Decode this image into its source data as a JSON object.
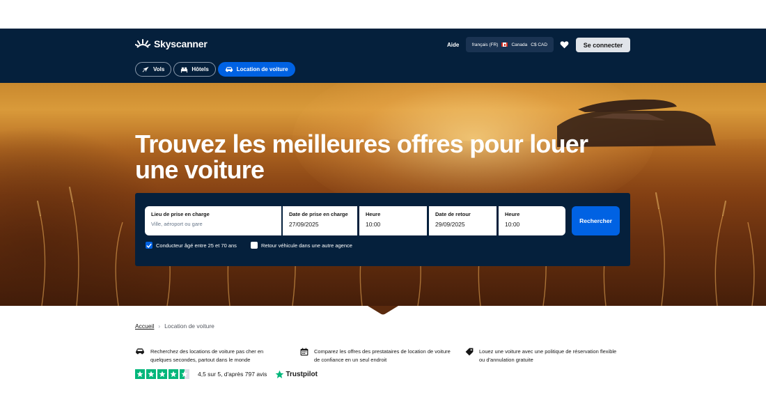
{
  "brand": {
    "name": "Skyscanner"
  },
  "header": {
    "help_label": "Aide",
    "locale": {
      "language": "français (FR)",
      "country": "Canada",
      "currency": "C$ CAD"
    },
    "login_label": "Se connecter"
  },
  "nav": {
    "tabs": [
      {
        "label": "Vols",
        "icon": "plane-icon",
        "active": false
      },
      {
        "label": "Hôtels",
        "icon": "bed-icon",
        "active": false
      },
      {
        "label": "Location de voiture",
        "icon": "car-icon",
        "active": true
      }
    ]
  },
  "hero": {
    "headline": "Trouvez les meilleures offres pour louer une voiture"
  },
  "search": {
    "pickup_location": {
      "label": "Lieu de prise en charge",
      "placeholder": "Ville, aéroport ou gare"
    },
    "pickup_date": {
      "label": "Date de prise en charge",
      "value": "27/09/2025"
    },
    "pickup_time": {
      "label": "Heure",
      "value": "10:00"
    },
    "return_date": {
      "label": "Date de retour",
      "value": "29/09/2025"
    },
    "return_time": {
      "label": "Heure",
      "value": "10:00"
    },
    "submit_label": "Rechercher",
    "options": [
      {
        "label": "Conducteur âgé entre 25 et 70 ans",
        "checked": true
      },
      {
        "label": "Retour véhicule dans une autre agence",
        "checked": false
      }
    ]
  },
  "breadcrumb": {
    "home": "Accueil",
    "separator": "›",
    "current": "Location de voiture"
  },
  "features": [
    {
      "icon": "car-icon",
      "text": "Recherchez des locations de voiture pas cher en quelques secondes, partout dans le monde"
    },
    {
      "icon": "calendar-icon",
      "text": "Comparez les offres des prestataires de location de voiture de confiance en un seul endroit"
    },
    {
      "icon": "tag-icon",
      "text": "Louez une voiture avec une politique de réservation flexible ou d'annulation gratuite"
    }
  ],
  "rating": {
    "stars": 4.5,
    "text": "4,5 sur 5, d'après 797 avis",
    "provider": "Trustpilot"
  },
  "colors": {
    "navy": "#05203c",
    "accent": "#0062e3",
    "trustpilot_green": "#00b67a"
  }
}
